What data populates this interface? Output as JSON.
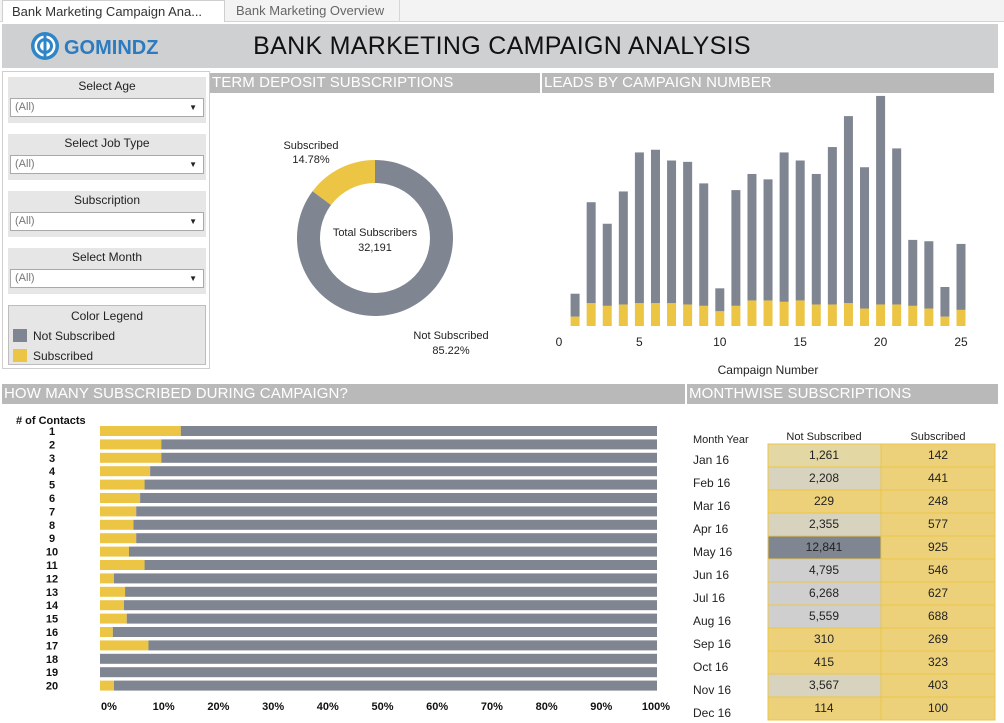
{
  "tabs": [
    {
      "label": "Bank Marketing Campaign Ana..."
    },
    {
      "label": "Bank Marketing Overview"
    }
  ],
  "header": {
    "logo_text": "GOMINDZ",
    "title": "BANK MARKETING CAMPAIGN ANALYSIS"
  },
  "filters": [
    {
      "label": "Select Age",
      "value": "(All)"
    },
    {
      "label": "Select Job Type",
      "value": "(All)"
    },
    {
      "label": "Subscription",
      "value": "(All)"
    },
    {
      "label": "Select Month",
      "value": "(All)"
    }
  ],
  "legend": {
    "title": "Color Legend",
    "items": [
      {
        "label": "Not Subscribed",
        "color": "#7f8591"
      },
      {
        "label": "Subscribed",
        "color": "#ecc545"
      }
    ]
  },
  "sections": {
    "term": "TERM DEPOSIT SUBSCRIPTIONS",
    "leads": "LEADS BY CAMPAIGN NUMBER",
    "during": "HOW MANY SUBSCRIBED DURING CAMPAIGN?",
    "monthwise": "MONTHWISE SUBSCRIPTIONS"
  },
  "colors": {
    "not_subscribed": "#7f8591",
    "subscribed": "#ecc545",
    "section_bar": "#b9b9b9"
  },
  "chart_data": [
    {
      "type": "pie",
      "name": "term_deposit",
      "center_label": "Total Subscribers",
      "center_value": "32,191",
      "slices": [
        {
          "label": "Subscribed",
          "pct_label": "14.78%",
          "value": 14.78
        },
        {
          "label": "Not Subscribed",
          "pct_label": "85.22%",
          "value": 85.22
        }
      ]
    },
    {
      "type": "bar",
      "name": "leads_by_campaign",
      "xlabel": "Campaign Number",
      "xticks": [
        "0",
        "5",
        "10",
        "15",
        "20",
        "25"
      ],
      "x": [
        1,
        2,
        3,
        4,
        5,
        6,
        7,
        8,
        9,
        10,
        11,
        12,
        13,
        14,
        15,
        16,
        17,
        18,
        19,
        20,
        21,
        22,
        23,
        24,
        25
      ],
      "series": [
        {
          "name": "Not Subscribed",
          "values": [
            1700,
            7500,
            6100,
            8400,
            11200,
            11400,
            10600,
            10600,
            9100,
            1700,
            8600,
            9400,
            9000,
            11100,
            10400,
            9700,
            11700,
            13900,
            10500,
            15500,
            11600,
            4900,
            5000,
            2200,
            4900
          ]
        },
        {
          "name": "Subscribed",
          "values": [
            700,
            1700,
            1500,
            1600,
            1700,
            1700,
            1700,
            1600,
            1500,
            1100,
            1500,
            1900,
            1900,
            1800,
            1900,
            1600,
            1600,
            1700,
            1300,
            1600,
            1600,
            1500,
            1300,
            700,
            1200
          ]
        }
      ]
    },
    {
      "type": "bar",
      "name": "subscribed_during_campaign",
      "orientation": "horizontal",
      "stacked": "percent",
      "ylabel": "# of Contacts",
      "categories": [
        "1",
        "2",
        "3",
        "4",
        "5",
        "6",
        "7",
        "8",
        "9",
        "10",
        "11",
        "12",
        "13",
        "14",
        "15",
        "16",
        "17",
        "18",
        "19",
        "20"
      ],
      "xticks": [
        "0%",
        "10%",
        "20%",
        "30%",
        "40%",
        "50%",
        "60%",
        "70%",
        "80%",
        "90%",
        "100%"
      ],
      "series": [
        {
          "name": "Subscribed",
          "values": [
            14.5,
            11.0,
            11.0,
            9.0,
            8.0,
            7.2,
            6.5,
            6.0,
            6.5,
            5.2,
            8.0,
            2.5,
            4.5,
            4.3,
            4.8,
            2.3,
            8.7,
            0,
            0,
            2.5
          ]
        },
        {
          "name": "Not Subscribed",
          "values": [
            85.5,
            89.0,
            89.0,
            91.0,
            92.0,
            92.8,
            93.5,
            94.0,
            93.5,
            94.8,
            92.0,
            97.5,
            95.5,
            95.7,
            95.2,
            97.7,
            91.3,
            100,
            100,
            97.5
          ]
        }
      ]
    },
    {
      "type": "table",
      "name": "monthwise_subscriptions",
      "columns": [
        "Month Year",
        "Not Subscribed",
        "Subscribed"
      ],
      "rows": [
        {
          "month": "Jan 16",
          "not_sub": "1,261",
          "sub": "142"
        },
        {
          "month": "Feb 16",
          "not_sub": "2,208",
          "sub": "441"
        },
        {
          "month": "Mar 16",
          "not_sub": "229",
          "sub": "248"
        },
        {
          "month": "Apr 16",
          "not_sub": "2,355",
          "sub": "577"
        },
        {
          "month": "May 16",
          "not_sub": "12,841",
          "sub": "925"
        },
        {
          "month": "Jun 16",
          "not_sub": "4,795",
          "sub": "546"
        },
        {
          "month": "Jul 16",
          "not_sub": "6,268",
          "sub": "627"
        },
        {
          "month": "Aug 16",
          "not_sub": "5,559",
          "sub": "688"
        },
        {
          "month": "Sep 16",
          "not_sub": "310",
          "sub": "269"
        },
        {
          "month": "Oct 16",
          "not_sub": "415",
          "sub": "323"
        },
        {
          "month": "Nov 16",
          "not_sub": "3,567",
          "sub": "403"
        },
        {
          "month": "Dec 16",
          "not_sub": "114",
          "sub": "100"
        }
      ]
    }
  ]
}
